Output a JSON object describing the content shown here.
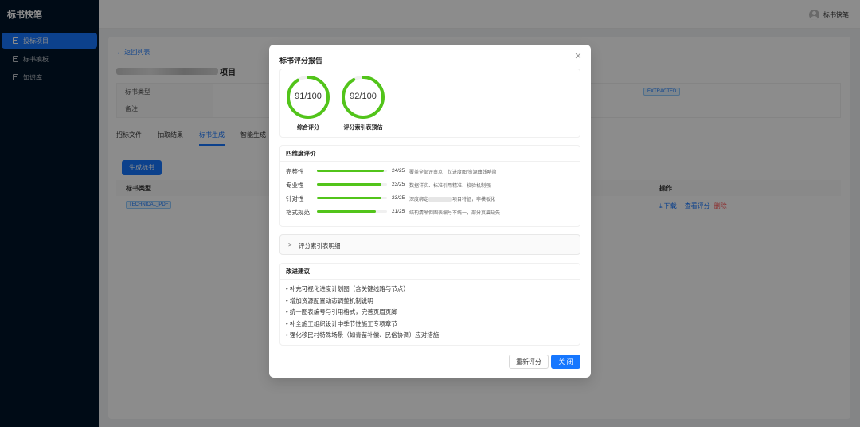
{
  "app": {
    "brand": "标书快笔",
    "user_name": "标书快笔"
  },
  "sidebar": {
    "items": [
      {
        "label": "投标项目",
        "active": true,
        "icon": "project-icon"
      },
      {
        "label": "标书模板",
        "active": false,
        "icon": "file-icon"
      },
      {
        "label": "知识库",
        "active": false,
        "icon": "book-icon"
      }
    ]
  },
  "main": {
    "back_label": "← 返回列表",
    "project_title_suffix": "项目",
    "info": [
      {
        "label": "标书类型"
      },
      {
        "label": "备注"
      }
    ],
    "status_tag": "EXTRACTED",
    "tabs": [
      {
        "label": "招标文件",
        "active": false
      },
      {
        "label": "抽取结果",
        "active": false
      },
      {
        "label": "标书生成",
        "active": true
      },
      {
        "label": "智能生成",
        "active": false
      }
    ],
    "generate_button": "生成标书",
    "table": {
      "col_type": "标书类型",
      "col_action": "操作",
      "rows": [
        {
          "type": "TECHNICAL_PDF",
          "download": "下载",
          "view_score": "查看评分",
          "delete": "删除"
        }
      ]
    }
  },
  "modal": {
    "title": "标书评分报告",
    "scores": [
      {
        "value": "91/100",
        "score": 91,
        "label": "综合评分"
      },
      {
        "value": "92/100",
        "score": 92,
        "label": "评分索引表预估"
      }
    ],
    "dimension_title": "四维度评价",
    "dimensions": [
      {
        "name": "完整性",
        "score": 24,
        "max": 25,
        "score_text": "24/25",
        "comment": "覆盖全部评审点，仅进度图/资源曲线略简"
      },
      {
        "name": "专业性",
        "score": 23,
        "max": 25,
        "score_text": "23/25",
        "comment": "数据详实、标准引用精准、校验机制强"
      },
      {
        "name": "针对性",
        "score": 23,
        "max": 25,
        "score_text": "23/25",
        "comment_pre": "深度绑定",
        "comment_post": "项目特征，非模板化"
      },
      {
        "name": "格式规范",
        "score": 21,
        "max": 25,
        "score_text": "21/25",
        "comment": "结构清晰但图表编号不统一，部分页眉缺失"
      }
    ],
    "collapse_label": "评分索引表明细",
    "suggest_title": "改进建议",
    "suggestions": [
      "• 补充可视化进度计划图（含关键线路与节点）",
      "• 增加资源配置动态调整机制说明",
      "• 统一图表编号与引用格式，完善页眉页脚",
      "• 补全施工组织设计中季节性施工专项章节",
      "• 强化移民村特殊场景（如青苗补偿、民俗协调）应对措施"
    ],
    "rescore_button": "重新评分",
    "close_button": "关 闭"
  },
  "colors": {
    "primary": "#1677ff",
    "success": "#52c41a",
    "danger": "#ff4d4f",
    "sidebar_bg": "#001529"
  }
}
